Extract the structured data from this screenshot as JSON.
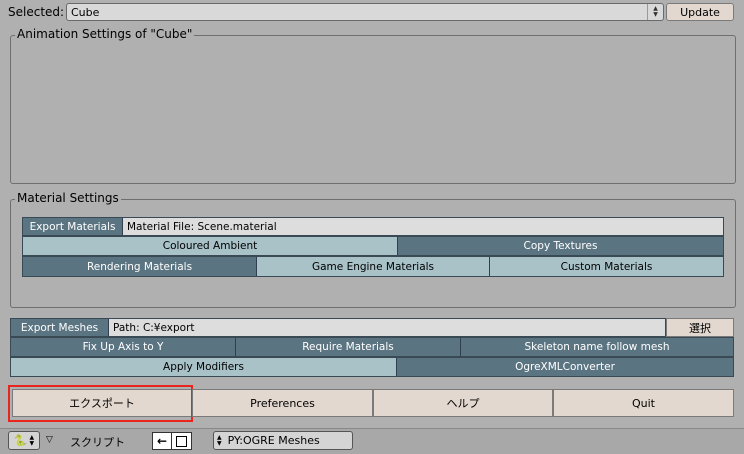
{
  "header": {
    "selected_label": "Selected:",
    "selected_value": "Cube",
    "update_label": "Update"
  },
  "animation": {
    "title": "Animation Settings of \"Cube\""
  },
  "material": {
    "title": "Material Settings",
    "export_materials_label": "Export Materials",
    "material_file": "Material File: Scene.material",
    "coloured_ambient": "Coloured Ambient",
    "copy_textures": "Copy Textures",
    "rendering_materials": "Rendering Materials",
    "game_engine_materials": "Game Engine Materials",
    "custom_materials": "Custom Materials"
  },
  "meshes": {
    "export_meshes_label": "Export Meshes",
    "path": "Path: C:¥export",
    "browse_label": "選択",
    "fix_up_axis": "Fix Up Axis to Y",
    "require_materials": "Require Materials",
    "skeleton_name": "Skeleton name follow mesh",
    "apply_modifiers": "Apply Modifiers",
    "ogre_xml_converter": "OgreXMLConverter"
  },
  "actions": {
    "export": "エクスポート",
    "preferences": "Preferences",
    "help": "ヘルプ",
    "quit": "Quit"
  },
  "bottombar": {
    "script_label": "スクリプト",
    "script_name": "PY:OGRE Meshes"
  },
  "colors": {
    "background": "#b0b0b0",
    "toggle_on": "#5b7482",
    "toggle_off": "#a8c2c8",
    "button": "#e2d8cf",
    "highlight": "#e8251f"
  }
}
